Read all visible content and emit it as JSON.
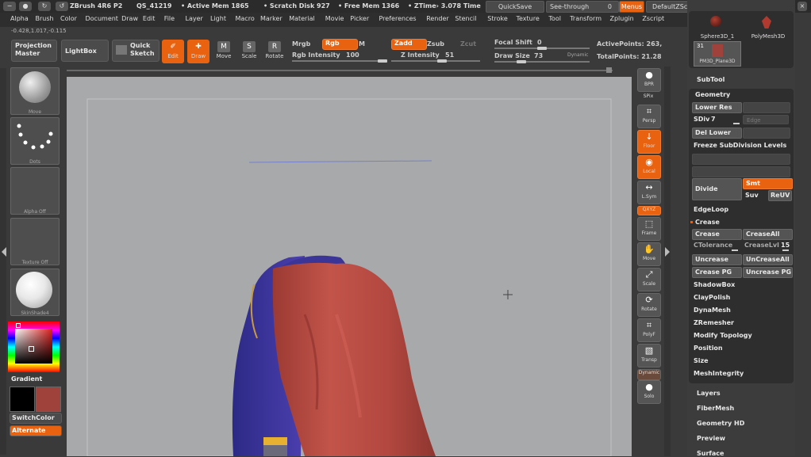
{
  "titlebar": {
    "app": "ZBrush 4R6 P2",
    "session": "QS_41219",
    "active_mem": "• Active Mem 1865",
    "scratch_disk": "• Scratch Disk 927",
    "free_mem": "• Free Mem 1366",
    "ztime": "• ZTime› 3.078 Time",
    "quicksave": "QuickSave",
    "see_through": "See-through",
    "see_through_value": "0",
    "menus": "Menus",
    "script": "DefaultZScript"
  },
  "menubar": [
    "Alpha",
    "Brush",
    "Color",
    "Document",
    "Draw",
    "Edit",
    "File",
    "Layer",
    "Light",
    "Macro",
    "Marker",
    "Material",
    "Movie",
    "Picker",
    "Preferences",
    "Render",
    "Stencil",
    "Stroke",
    "Texture",
    "Tool",
    "Transform",
    "Zplugin",
    "Zscript"
  ],
  "coords": "-0.428,1.017,-0.115",
  "shelf": {
    "projection_master": "Projection Master",
    "lightbox": "LightBox",
    "quick_sketch": "Quick Sketch",
    "tools": [
      {
        "label": "Edit",
        "icon": "edit-icon",
        "glyph": "✐",
        "active": true
      },
      {
        "label": "Draw",
        "icon": "draw-icon",
        "glyph": "✚",
        "active": true
      },
      {
        "label": "Move",
        "icon": "move-icon",
        "glyph": "M",
        "active": false
      },
      {
        "label": "Scale",
        "icon": "scale-icon",
        "glyph": "S",
        "active": false
      },
      {
        "label": "Rotate",
        "icon": "rotate-icon",
        "glyph": "R",
        "active": false
      }
    ],
    "mrgb": "Mrgb",
    "rgb": "Rgb",
    "m": "M",
    "rgb_intensity_label": "Rgb Intensity",
    "rgb_intensity": "100",
    "zadd": "Zadd",
    "zsub": "Zsub",
    "zcut": "Zcut",
    "z_intensity_label": "Z Intensity",
    "z_intensity": "51",
    "focal_shift_label": "Focal Shift",
    "focal_shift": "0",
    "draw_size_label": "Draw Size",
    "draw_size": "73",
    "dynamic": "Dynamic",
    "active_points": "ActivePoints: 263,",
    "total_points": "TotalPoints: 21.28"
  },
  "leftshelf": {
    "brush": "Move",
    "stroke": "Dots",
    "alpha": "Alpha Off",
    "texture": "Texture Off",
    "material": "SkinShade4",
    "gradient": "Gradient",
    "switchcolor": "SwitchColor",
    "alternate": "Alternate",
    "colors": {
      "main": "#000000",
      "secondary": "#a0423c"
    }
  },
  "rightcol": [
    {
      "label": "BPR",
      "glyph": "●",
      "active": false
    },
    {
      "label": "SPix",
      "glyph": "",
      "active": false
    },
    {
      "label": "Persp",
      "glyph": "⌗",
      "active": false
    },
    {
      "label": "Floor",
      "glyph": "↓",
      "active": true
    },
    {
      "label": "Local",
      "glyph": "◉",
      "active": true
    },
    {
      "label": "L.Sym",
      "glyph": "↔",
      "active": false
    },
    {
      "label": "QXYZ",
      "glyph": "",
      "active": true
    },
    {
      "label": "Frame",
      "glyph": "⬚",
      "active": false
    },
    {
      "label": "Move",
      "glyph": "✋",
      "active": false
    },
    {
      "label": "Scale",
      "glyph": "⤢",
      "active": false
    },
    {
      "label": "Rotate",
      "glyph": "⟳",
      "active": false
    },
    {
      "label": "PolyF",
      "glyph": "⌗",
      "active": false
    },
    {
      "label": "Transp",
      "glyph": "▧",
      "active": false
    },
    {
      "label": "Dynamic",
      "glyph": "",
      "active": false
    },
    {
      "label": "Solo",
      "glyph": "●",
      "active": false
    }
  ],
  "rpanel": {
    "thumbs": [
      {
        "label": "Sphere3D_1"
      },
      {
        "label": "PolyMesh3D"
      },
      {
        "label": "PM3D_Plane3D",
        "count": "31"
      }
    ],
    "subtool": "SubTool",
    "geometry": "Geometry",
    "lower_res": "Lower Res",
    "sdiv_label": "SDiv",
    "sdiv": "7",
    "edge": "Edge",
    "del_lower": "Del Lower",
    "freeze": "Freeze SubDivision Levels",
    "divide": "Divide",
    "smt": "Smt",
    "suv": "Suv",
    "reuv": "ReUV",
    "edgeloop": "EdgeLoop",
    "crease_section": "Crease",
    "crease": "Crease",
    "crease_all": "CreaseAll",
    "ctolerance": "CTolerance",
    "crease_lvl_label": "CreaseLvl",
    "crease_lvl": "15",
    "uncrease": "Uncrease",
    "uncrease_all": "UnCreaseAll",
    "crease_pg": "Crease PG",
    "uncrease_pg": "Uncrease PG",
    "items": [
      "ShadowBox",
      "ClayPolish",
      "DynaMesh",
      "ZRemesher",
      "Modify Topology",
      "Position",
      "Size",
      "MeshIntegrity"
    ],
    "sections": [
      "Layers",
      "FiberMesh",
      "Geometry HD",
      "Preview",
      "Surface"
    ]
  },
  "colors": {
    "accent": "#e8620f",
    "cape": "#b84a3f",
    "suit": "#3a3396",
    "canvas": "#a8a9ab"
  }
}
